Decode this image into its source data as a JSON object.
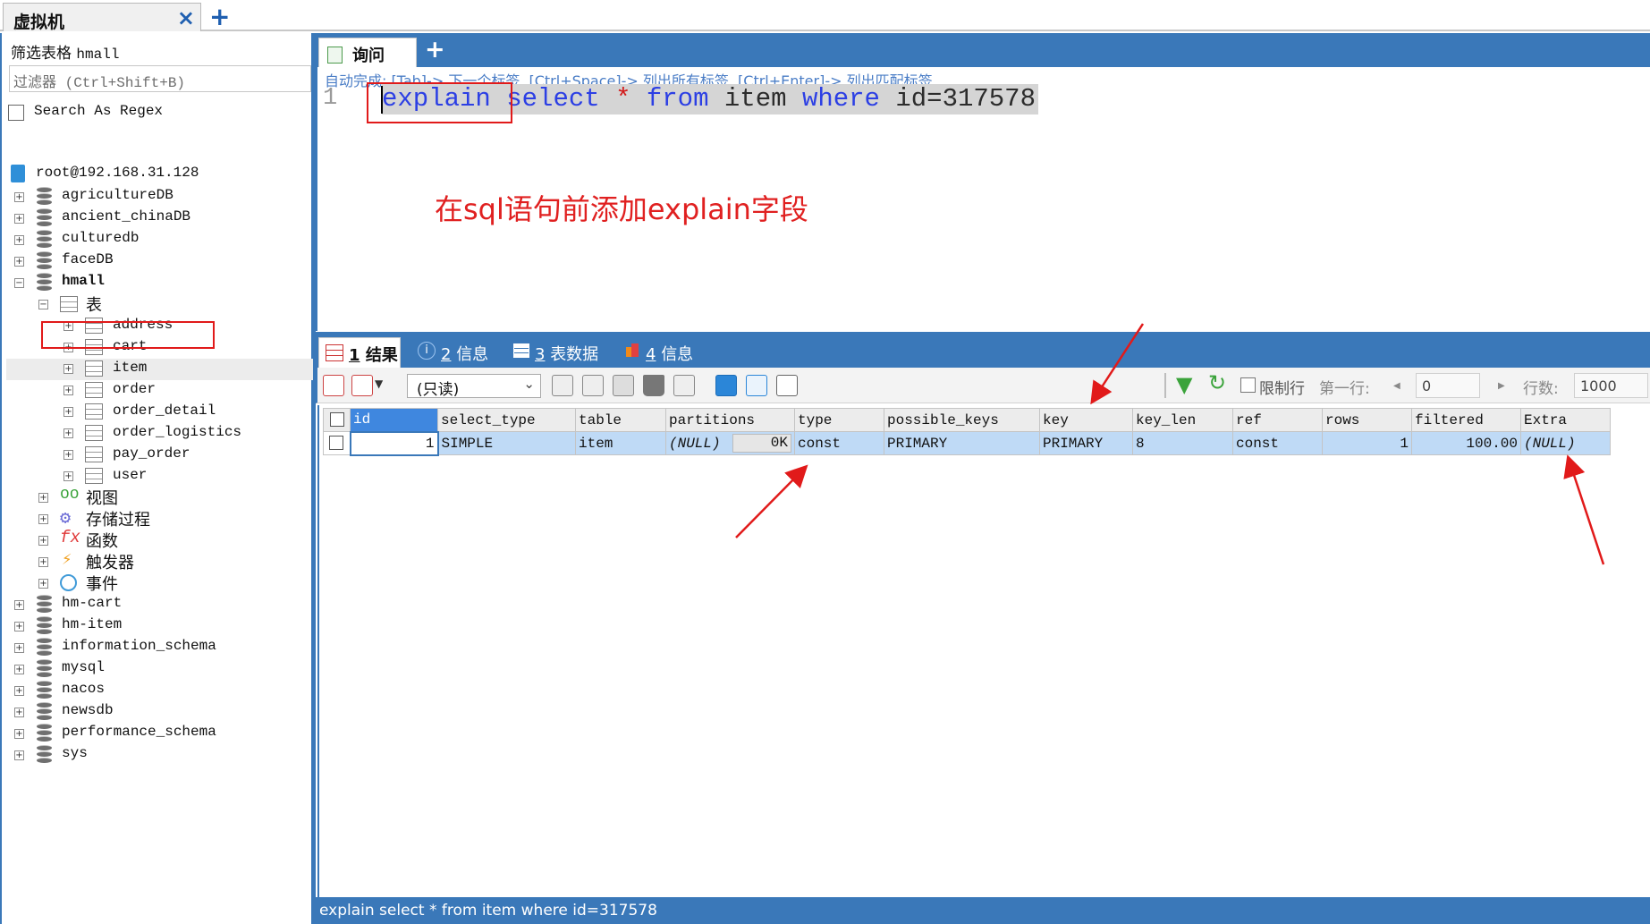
{
  "window": {
    "connection_tab": "虚拟机",
    "close_symbol": "×",
    "add_symbol": "+"
  },
  "sidebar": {
    "filter_title_prefix": "筛选表格",
    "filter_db": "hmall",
    "filter_placeholder": "过滤器 (Ctrl+Shift+B)",
    "regex_label": "Search As Regex",
    "connection": "root@192.168.31.128",
    "databases_top": [
      "agricultureDB",
      "ancient_chinaDB",
      "culturedb",
      "faceDB"
    ],
    "open_db": "hmall",
    "tables_folder": "表",
    "tables": [
      "address",
      "cart",
      "item",
      "order",
      "order_detail",
      "order_logistics",
      "pay_order",
      "user"
    ],
    "folders": [
      "视图",
      "存储过程",
      "函数",
      "触发器",
      "事件"
    ],
    "databases_bottom": [
      "hm-cart",
      "hm-item",
      "information_schema",
      "mysql",
      "nacos",
      "newsdb",
      "performance_schema",
      "sys"
    ]
  },
  "query_tab": {
    "label": "询问",
    "add": "+"
  },
  "editor": {
    "hint": "自动完成: [Tab]-> 下一个标签, [Ctrl+Space]-> 列出所有标签, [Ctrl+Enter]-> 列出匹配标签",
    "line_number": "1",
    "code": {
      "explain": "explain",
      "select": "select",
      "star": "*",
      "from": "from",
      "table": "item",
      "where": "where",
      "cond": "id=317578"
    },
    "annotation": "在sql语句前添加explain字段"
  },
  "result_tabs": [
    {
      "num": "1",
      "label": "结果"
    },
    {
      "num": "2",
      "label": "信息"
    },
    {
      "num": "3",
      "label": "表数据"
    },
    {
      "num": "4",
      "label": "信息"
    }
  ],
  "toolbar": {
    "mode": "(只读)",
    "limit_label": "限制行",
    "first_row_label": "第一行:",
    "first_row_value": "0",
    "rows_label": "行数:",
    "rows_value": "1000"
  },
  "results": {
    "columns": [
      "id",
      "select_type",
      "table",
      "partitions",
      "type",
      "possible_keys",
      "key",
      "key_len",
      "ref",
      "rows",
      "filtered",
      "Extra"
    ],
    "row": {
      "id": "1",
      "select_type": "SIMPLE",
      "table": "item",
      "partitions": "(NULL)",
      "partitions_ok": "0K",
      "type": "const",
      "possible_keys": "PRIMARY",
      "key": "PRIMARY",
      "key_len": "8",
      "ref": "const",
      "rows": "1",
      "filtered": "100.00",
      "extra": "(NULL)"
    }
  },
  "status_bar": "explain select * from item where id=317578",
  "colors": {
    "accent_blue": "#3a78b9",
    "selection_blue": "#bfdaf6",
    "annotation_red": "#e02020"
  }
}
